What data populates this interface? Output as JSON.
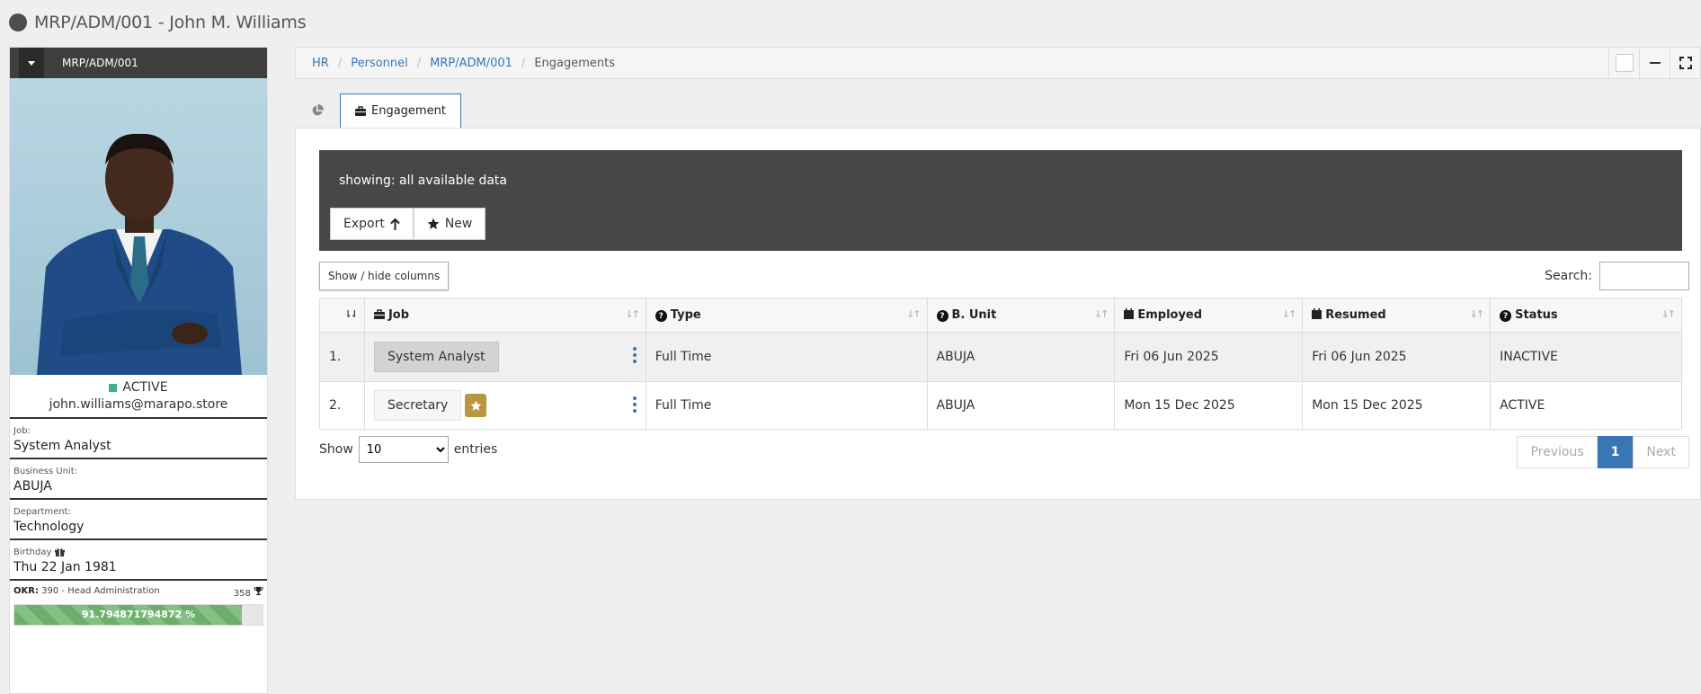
{
  "page": {
    "title": "MRP/ADM/001 - John M. Williams"
  },
  "profile": {
    "code": "MRP/ADM/001",
    "status": "ACTIVE",
    "email": "john.williams@marapo.store",
    "job_label": "Job:",
    "job": "System Analyst",
    "unit_label": "Business Unit:",
    "unit": "ABUJA",
    "dept_label": "Department:",
    "dept": "Technology",
    "birthday_label": "Birthday",
    "birthday": "Thu 22 Jan 1981",
    "okr_label": "OKR:",
    "okr_text": "390 - Head Administration",
    "okr_count": "358",
    "okr_progress_text": "91.794871794872 %",
    "okr_progress": 91.794871794872,
    "status_color": "#3fb27f"
  },
  "breadcrumb": {
    "items": [
      "HR",
      "Personnel",
      "MRP/ADM/001"
    ],
    "current": "Engagements"
  },
  "tabs": {
    "active": "Engagement"
  },
  "toolbar": {
    "showing": "showing: all available data",
    "export_label": "Export",
    "new_label": "New"
  },
  "table": {
    "colvis_label": "Show / hide columns",
    "search_label": "Search:",
    "search_value": "",
    "headers": {
      "job": "Job",
      "type": "Type",
      "unit": "B. Unit",
      "employed": "Employed",
      "resumed": "Resumed",
      "status": "Status"
    },
    "rows": [
      {
        "num": "1.",
        "job": "System Analyst",
        "type": "Full Time",
        "unit": "ABUJA",
        "employed": "Fri 06 Jun 2025",
        "resumed": "Fri 06 Jun 2025",
        "status": "INACTIVE"
      },
      {
        "num": "2.",
        "job": "Secretary",
        "type": "Full Time",
        "unit": "ABUJA",
        "employed": "Mon 15 Dec 2025",
        "resumed": "Mon 15 Dec 2025",
        "status": "ACTIVE"
      }
    ]
  },
  "footer": {
    "show_label": "Show",
    "entries_label": "entries",
    "length_value": "10",
    "prev_label": "Previous",
    "page": "1",
    "next_label": "Next"
  },
  "colors": {
    "accent": "#3a76b4",
    "dark": "#474747",
    "gold": "#b8973e",
    "progress": "#6cae6c"
  }
}
